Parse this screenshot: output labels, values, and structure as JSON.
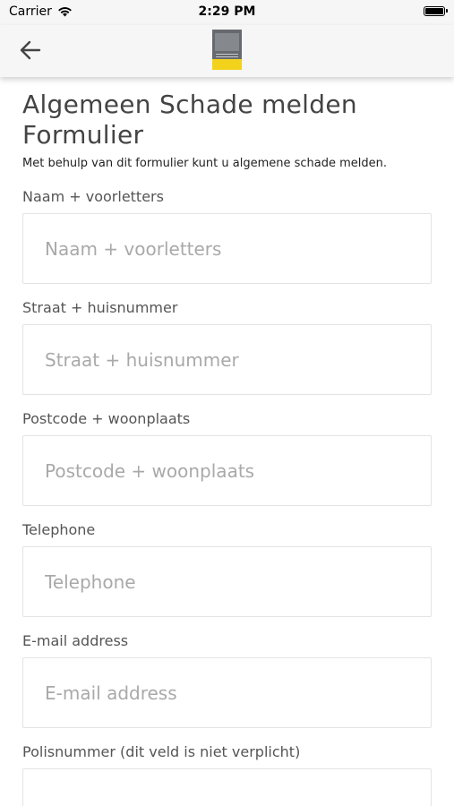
{
  "status_bar": {
    "carrier": "Carrier",
    "time": "2:29 PM"
  },
  "nav": {
    "back_icon": "arrow-left-icon",
    "logo_icon": "company-logo"
  },
  "form": {
    "title": "Algemeen Schade melden Formulier",
    "subtitle": "Met behulp van dit formulier kunt u algemene schade melden.",
    "fields": [
      {
        "label": "Naam + voorletters",
        "placeholder": "Naam + voorletters",
        "value": ""
      },
      {
        "label": "Straat + huisnummer",
        "placeholder": "Straat + huisnummer",
        "value": ""
      },
      {
        "label": "Postcode + woonplaats",
        "placeholder": "Postcode + woonplaats",
        "value": ""
      },
      {
        "label": "Telephone",
        "placeholder": "Telephone",
        "value": ""
      },
      {
        "label": "E-mail address",
        "placeholder": "E-mail address",
        "value": ""
      },
      {
        "label": "Polisnummer (dit veld is niet verplicht)",
        "placeholder": "",
        "value": ""
      }
    ]
  },
  "colors": {
    "logo_yellow": "#f2d21b",
    "logo_gray": "#666a6e",
    "header_background": "#f6f6f6"
  }
}
